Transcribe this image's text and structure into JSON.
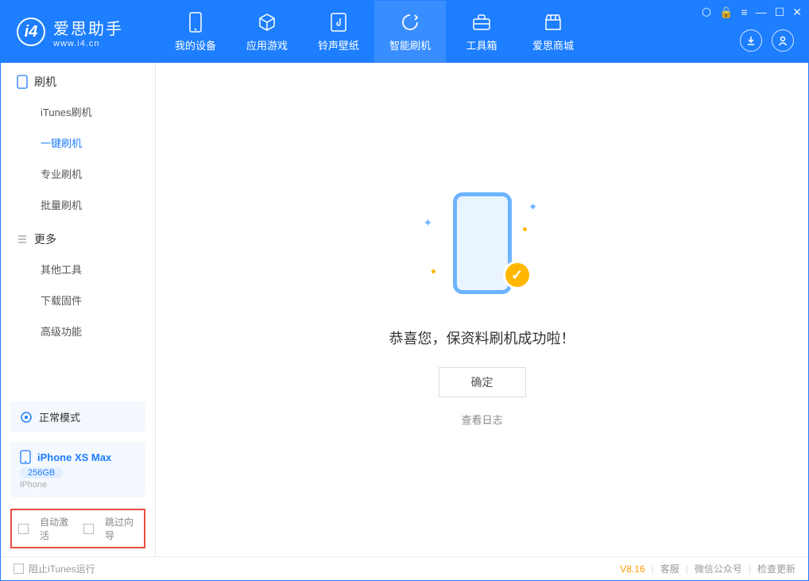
{
  "app": {
    "title": "爱思助手",
    "subtitle": "www.i4.cn"
  },
  "nav": {
    "items": [
      {
        "label": "我的设备"
      },
      {
        "label": "应用游戏"
      },
      {
        "label": "铃声壁纸"
      },
      {
        "label": "智能刷机"
      },
      {
        "label": "工具箱"
      },
      {
        "label": "爱思商城"
      }
    ]
  },
  "sidebar": {
    "section1_title": "刷机",
    "section1_items": [
      {
        "label": "iTunes刷机"
      },
      {
        "label": "一键刷机"
      },
      {
        "label": "专业刷机"
      },
      {
        "label": "批量刷机"
      }
    ],
    "section2_title": "更多",
    "section2_items": [
      {
        "label": "其他工具"
      },
      {
        "label": "下载固件"
      },
      {
        "label": "高级功能"
      }
    ],
    "mode_label": "正常模式",
    "device_name": "iPhone XS Max",
    "device_storage": "256GB",
    "device_type": "iPhone",
    "checkbox1": "自动激活",
    "checkbox2": "跳过向导"
  },
  "main": {
    "success_text": "恭喜您，保资料刷机成功啦！",
    "ok_button": "确定",
    "log_link": "查看日志"
  },
  "footer": {
    "block_itunes": "阻止iTunes运行",
    "version": "V8.16",
    "link1": "客服",
    "link2": "微信公众号",
    "link3": "检查更新"
  }
}
